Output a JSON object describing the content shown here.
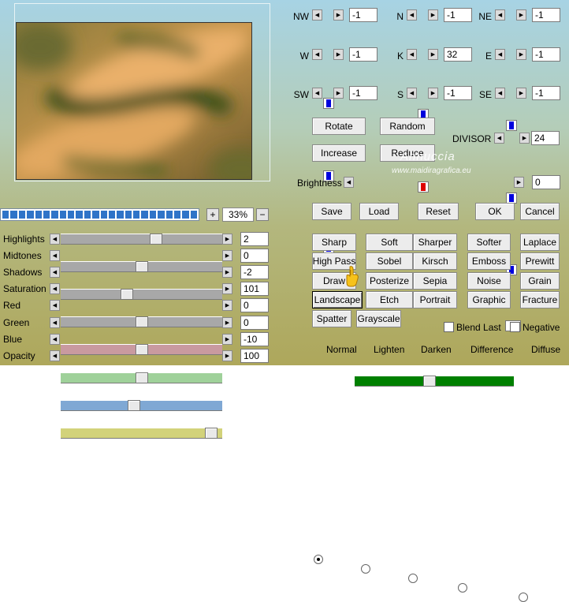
{
  "zoom": {
    "value": "33%",
    "plus": "+",
    "minus": "−"
  },
  "progress": {
    "value": 1.0,
    "color": "#2f74c8"
  },
  "sliders": [
    {
      "label": "Highlights",
      "value": "2",
      "pos": 0.6,
      "color": "#a8a8a8"
    },
    {
      "label": "Midtones",
      "value": "0",
      "pos": 0.5,
      "color": "#a8a8a8"
    },
    {
      "label": "Shadows",
      "value": "-2",
      "pos": 0.4,
      "color": "#a8a8a8"
    },
    {
      "label": "Saturation",
      "value": "101",
      "pos": 0.5,
      "color": "#a8a8a8"
    },
    {
      "label": "Red",
      "value": "0",
      "pos": 0.5,
      "color": "#c99aa0"
    },
    {
      "label": "Green",
      "value": "0",
      "pos": 0.5,
      "color": "#9fd19a"
    },
    {
      "label": "Blue",
      "value": "-10",
      "pos": 0.45,
      "color": "#7fa8d4"
    },
    {
      "label": "Opacity",
      "value": "100",
      "pos": 0.97,
      "color": "#d2d27a"
    }
  ],
  "kernel": [
    [
      {
        "label": "NW",
        "value": "-1",
        "ind": "#0000dd"
      },
      {
        "label": "N",
        "value": "-1",
        "ind": "#0000dd"
      },
      {
        "label": "NE",
        "value": "-1",
        "ind": "#0000dd"
      }
    ],
    [
      {
        "label": "W",
        "value": "-1",
        "ind": "#0000dd"
      },
      {
        "label": "K",
        "value": "32",
        "ind": "#dd0000"
      },
      {
        "label": "E",
        "value": "-1",
        "ind": "#0000dd"
      }
    ],
    [
      {
        "label": "SW",
        "value": "-1",
        "ind": "#0000dd"
      },
      {
        "label": "S",
        "value": "-1",
        "ind": "#0000dd"
      },
      {
        "label": "SE",
        "value": "-1",
        "ind": "#0000dd"
      }
    ]
  ],
  "buttons": {
    "rotate": "Rotate",
    "random": "Random",
    "increase": "Increase",
    "reduce": "Reduce",
    "save": "Save",
    "load": "Load",
    "reset": "Reset",
    "ok": "OK",
    "cancel": "Cancel"
  },
  "divisor": {
    "label": "DIVISOR",
    "value": "24",
    "ind": "#ffff33"
  },
  "brightness": {
    "label": "Brightness",
    "value": "0",
    "pos": 0.47,
    "color": "#008000"
  },
  "presets": [
    [
      "Sharp",
      "Soft",
      "Sharper",
      "Softer",
      "Laplace"
    ],
    [
      "High Pass",
      "Sobel",
      "Kirsch",
      "Emboss",
      "Prewitt"
    ],
    [
      "Draw",
      "Posterize",
      "Sepia",
      "Noise",
      "Grain"
    ],
    [
      "Landscape",
      "Etch",
      "Portrait",
      "Graphic",
      "Fracture"
    ],
    [
      "Spatter",
      "Grayscale"
    ]
  ],
  "checkboxes": {
    "blend_last": "Blend Last",
    "negative": "Negative"
  },
  "modes": [
    "Normal",
    "Lighten",
    "Darken",
    "Difference",
    "Diffuse"
  ],
  "watermark": {
    "line1": "Annuccia",
    "line2": "www.maidiragrafica.eu"
  }
}
